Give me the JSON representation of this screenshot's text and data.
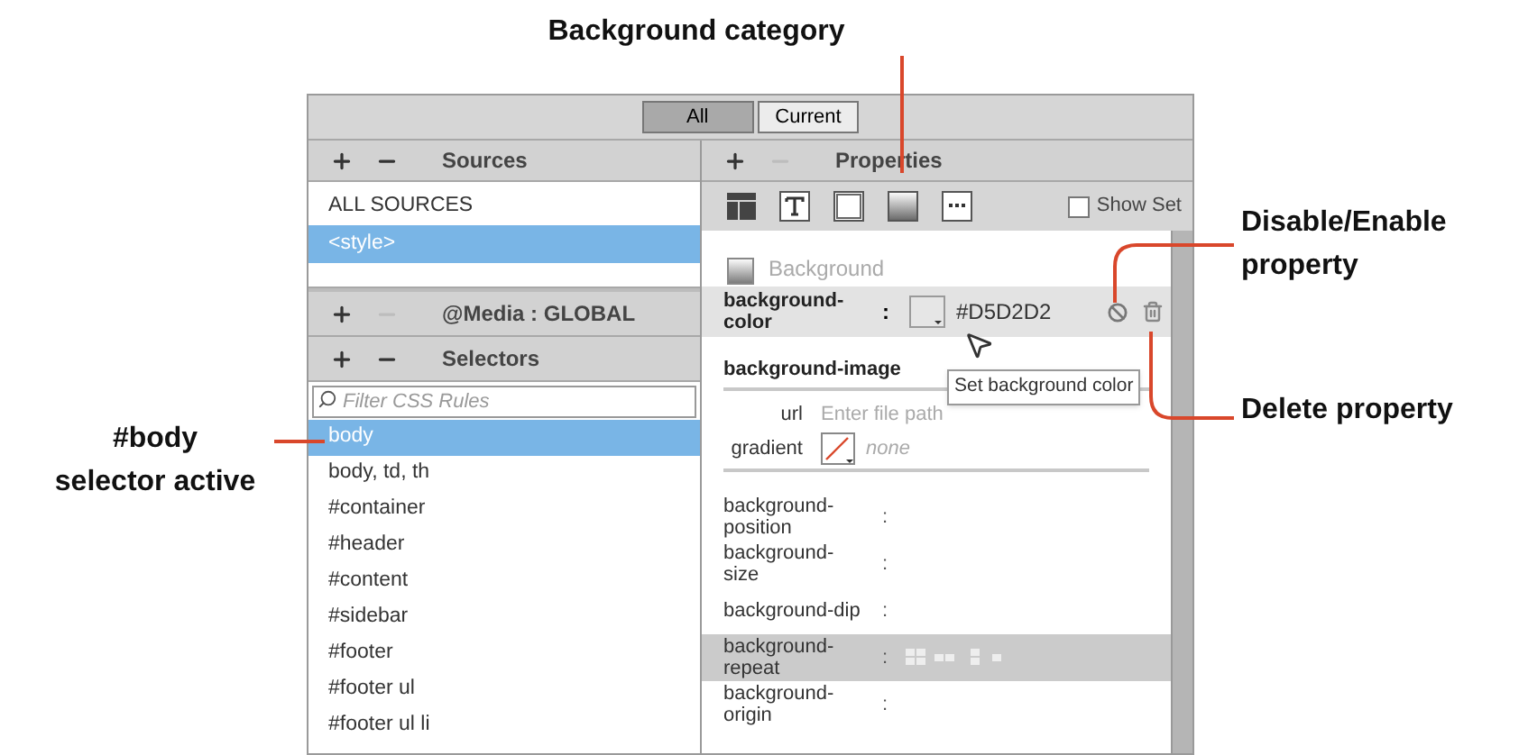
{
  "annotations": {
    "top": "Background category",
    "right_top": "Disable/Enable property",
    "right_bottom": "Delete property",
    "left": [
      "#body",
      "selector active"
    ]
  },
  "filter_tabs": [
    {
      "label": "All",
      "selected": true
    },
    {
      "label": "Current",
      "selected": false
    }
  ],
  "sources": {
    "title": "Sources",
    "minus_disabled": false,
    "items": [
      {
        "label": "ALL SOURCES",
        "selected": false
      },
      {
        "label": "<style>",
        "selected": true
      }
    ]
  },
  "media": {
    "title": "@Media :  GLOBAL",
    "minus_disabled": true
  },
  "selectors": {
    "title": "Selectors",
    "minus_disabled": false,
    "placeholder": "Filter CSS Rules",
    "items": [
      {
        "label": "body",
        "selected": true
      },
      {
        "label": "body, td, th",
        "selected": false
      },
      {
        "label": "#container",
        "selected": false
      },
      {
        "label": "#header",
        "selected": false
      },
      {
        "label": "#content",
        "selected": false
      },
      {
        "label": "#sidebar",
        "selected": false
      },
      {
        "label": "#footer",
        "selected": false
      },
      {
        "label": "#footer ul",
        "selected": false
      },
      {
        "label": "#footer ul li",
        "selected": false
      }
    ]
  },
  "properties": {
    "title": "Properties",
    "minus_disabled": true,
    "show_set": {
      "label": "Show Set",
      "checked": false
    },
    "section": "Background",
    "rows": [
      {
        "kind": "color",
        "name": "background-color",
        "colon": ":",
        "value": "#D5D2D2",
        "highlighted": true
      },
      {
        "kind": "heading",
        "name": "background-image"
      },
      {
        "kind": "url",
        "name": "url",
        "placeholder": "Enter file path"
      },
      {
        "kind": "gradient",
        "name": "gradient",
        "value": "none"
      },
      {
        "kind": "plain",
        "name": "background-position",
        "colon": ":",
        "highlighted": false
      },
      {
        "kind": "plain",
        "name": "background-size",
        "colon": ":",
        "highlighted": false
      },
      {
        "kind": "plain",
        "name": "background-dip",
        "colon": ":",
        "highlighted": false
      },
      {
        "kind": "repeat",
        "name": "background-repeat",
        "colon": ":",
        "highlighted": true
      },
      {
        "kind": "plain",
        "name": "background-origin",
        "colon": ":",
        "highlighted": false
      }
    ],
    "tooltip": "Set background color"
  }
}
